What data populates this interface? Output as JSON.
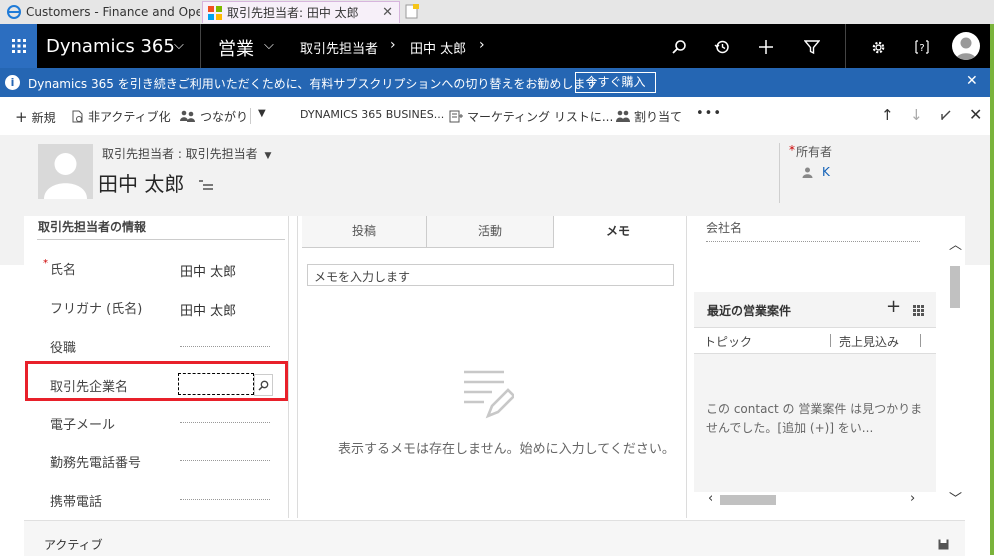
{
  "browser": {
    "tabs": [
      {
        "label": "Customers - Finance and Oper..."
      },
      {
        "label": "取引先担当者: 田中 太郎"
      }
    ]
  },
  "nav": {
    "app_title": "Dynamics 365",
    "area": "営業",
    "crumb1": "取引先担当者",
    "crumb2": "田中 太郎"
  },
  "notification": {
    "message": "Dynamics 365 を引き続きご利用いただくために、有料サブスクリプションへの切り替えをお勧めします",
    "button": "今すぐ購入"
  },
  "commands": {
    "new": "新規",
    "deactivate": "非アクティブ化",
    "connect": "つながり",
    "dynamics_business": "DYNAMICS 365 BUSINES...",
    "marketing_list": "マーケティング リストに...",
    "assign": "割り当て",
    "more": "•••"
  },
  "header": {
    "form_selector": "取引先担当者 : 取引先担当者",
    "name": "田中 太郎",
    "owner_label": "所有者",
    "owner_value": "K"
  },
  "contact_section": {
    "title": "取引先担当者の情報",
    "fields": [
      {
        "label": "氏名",
        "value": "田中 太郎",
        "required": true
      },
      {
        "label": "フリガナ (氏名)",
        "value": "田中 太郎"
      },
      {
        "label": "役職",
        "value": ""
      },
      {
        "label": "取引先企業名",
        "value": ""
      },
      {
        "label": "電子メール",
        "value": ""
      },
      {
        "label": "勤務先電話番号",
        "value": ""
      },
      {
        "label": "携帯電話",
        "value": ""
      }
    ]
  },
  "activity_tabs": [
    "投稿",
    "活動",
    "メモ"
  ],
  "notes": {
    "placeholder": "メモを入力します",
    "empty_message": "表示するメモは存在しません。始めに入力してください。"
  },
  "right_panel": {
    "company_label": "会社名",
    "opportunities_title": "最近の営業案件",
    "col_topic": "トピック",
    "col_revenue": "売上見込み",
    "empty_message": "この contact の 営業案件 は見つかりませんでした。[追加 (+)] をい..."
  },
  "footer": {
    "status": "アクティブ"
  }
}
